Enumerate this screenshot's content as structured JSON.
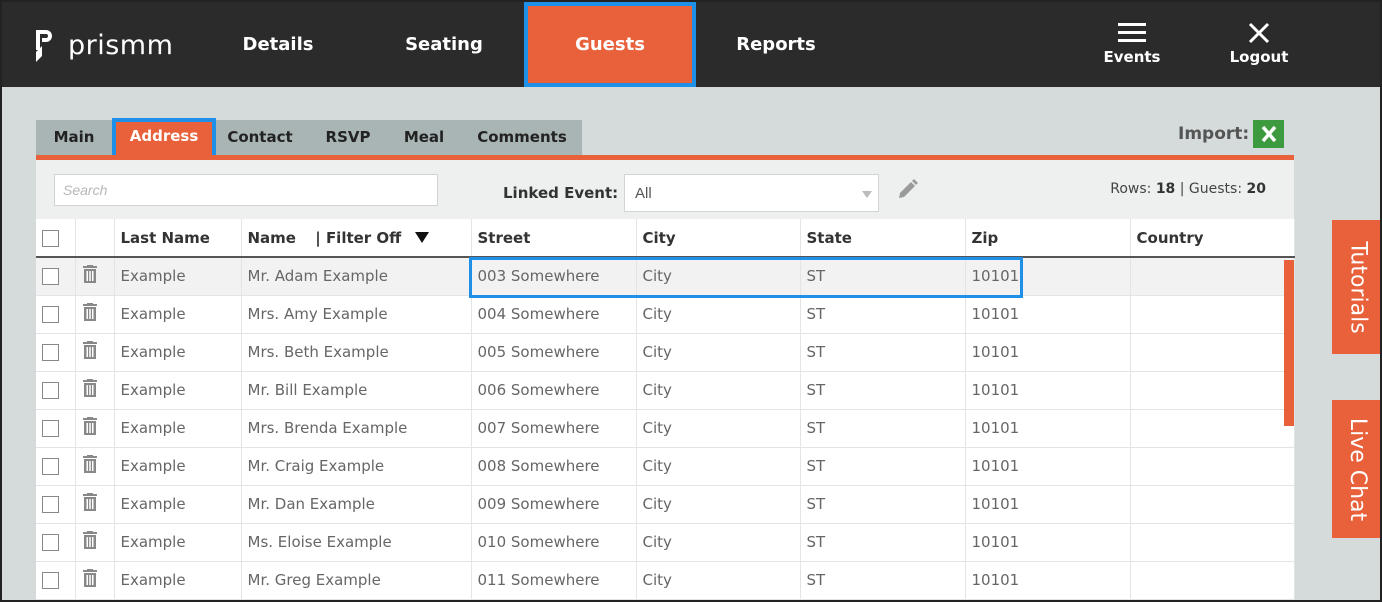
{
  "header": {
    "logo_text": "prismm",
    "nav": [
      {
        "label": "Details"
      },
      {
        "label": "Seating"
      },
      {
        "label": "Guests"
      },
      {
        "label": "Reports"
      }
    ],
    "events_label": "Events",
    "logout_label": "Logout"
  },
  "subtabs": [
    {
      "label": "Main"
    },
    {
      "label": "Address"
    },
    {
      "label": "Contact"
    },
    {
      "label": "RSVP"
    },
    {
      "label": "Meal"
    },
    {
      "label": "Comments"
    }
  ],
  "import_label": "Import:",
  "toolbar": {
    "search_placeholder": "Search",
    "linked_event_label": "Linked Event:",
    "linked_event_value": "All",
    "rows_label": "Rows:",
    "rows_count": "18",
    "separator": "|",
    "guests_label": "Guests:",
    "guests_count": "20"
  },
  "table": {
    "columns": {
      "last_name": "Last Name",
      "name": "Name",
      "filter": "Filter Off",
      "street": "Street",
      "city": "City",
      "state": "State",
      "zip": "Zip",
      "country": "Country"
    },
    "rows": [
      {
        "last": "Example",
        "name": "Mr. Adam Example",
        "street": "003 Somewhere",
        "city": "City",
        "state": "ST",
        "zip": "10101",
        "country": ""
      },
      {
        "last": "Example",
        "name": "Mrs. Amy Example",
        "street": "004 Somewhere",
        "city": "City",
        "state": "ST",
        "zip": "10101",
        "country": ""
      },
      {
        "last": "Example",
        "name": "Mrs. Beth Example",
        "street": "005 Somewhere",
        "city": "City",
        "state": "ST",
        "zip": "10101",
        "country": ""
      },
      {
        "last": "Example",
        "name": "Mr. Bill Example",
        "street": "006 Somewhere",
        "city": "City",
        "state": "ST",
        "zip": "10101",
        "country": ""
      },
      {
        "last": "Example",
        "name": "Mrs. Brenda Example",
        "street": "007 Somewhere",
        "city": "City",
        "state": "ST",
        "zip": "10101",
        "country": ""
      },
      {
        "last": "Example",
        "name": "Mr. Craig Example",
        "street": "008 Somewhere",
        "city": "City",
        "state": "ST",
        "zip": "10101",
        "country": ""
      },
      {
        "last": "Example",
        "name": "Mr. Dan Example",
        "street": "009 Somewhere",
        "city": "City",
        "state": "ST",
        "zip": "10101",
        "country": ""
      },
      {
        "last": "Example",
        "name": "Ms. Eloise Example",
        "street": "010 Somewhere",
        "city": "City",
        "state": "ST",
        "zip": "10101",
        "country": ""
      },
      {
        "last": "Example",
        "name": "Mr. Greg Example",
        "street": "011 Somewhere",
        "city": "City",
        "state": "ST",
        "zip": "10101",
        "country": ""
      }
    ]
  },
  "side_tabs": {
    "tutorials": "Tutorials",
    "live_chat": "Live Chat"
  },
  "colors": {
    "accent": "#e8613a",
    "highlight": "#1e90e8",
    "topbar": "#2b2b2b"
  }
}
